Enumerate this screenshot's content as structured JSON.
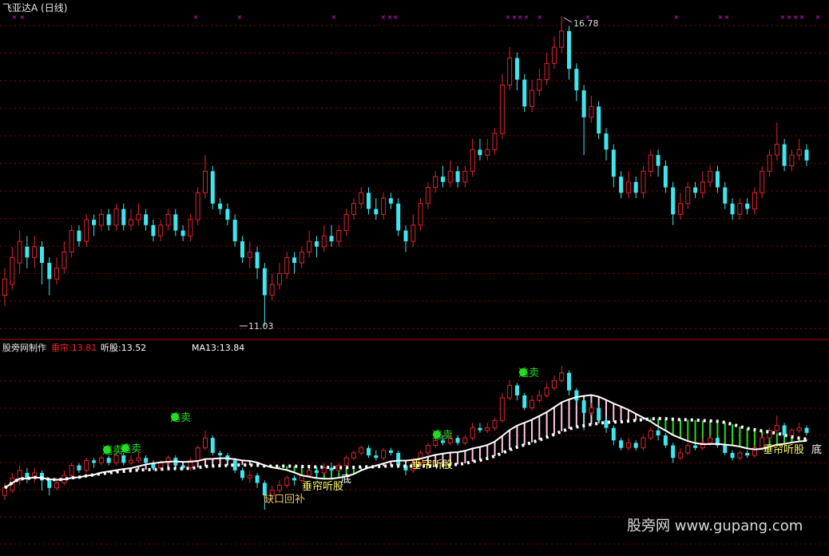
{
  "window": {
    "title": "飞亚达A (日线)"
  },
  "indicator_header": {
    "author_label": "股旁网制作",
    "items": [
      {
        "label": "垂帘",
        "value": "13.81",
        "color": "#ff2020"
      },
      {
        "label": "听股",
        "value": "13.52",
        "color": "#ffffff"
      },
      {
        "label": "MA13",
        "value": "13.84",
        "color": "#ffffff"
      }
    ]
  },
  "colors": {
    "background": "#000000",
    "up_candle": "#e0232d",
    "down_candle": "#3ee6ee",
    "grid": "#8b0000",
    "markers": "#e020e0",
    "signal_green": "#22dd22",
    "pink_hist": "#ffc8e6",
    "label_orange": "#e8c060",
    "label_yellow": "#ffff66"
  },
  "price_annotations": {
    "high": "16.78",
    "low": "11.03"
  },
  "signal_labels": {
    "sell": "逃卖",
    "curtain_stock": "垂帘听股",
    "gap_fill": "缺口回补",
    "bottom": "底"
  },
  "watermark": {
    "text": "股旁网  www.gupang.com"
  },
  "chart_data": {
    "type": "candlestick",
    "title": "飞亚达A (日线)",
    "ylim": [
      10.6,
      17.4
    ],
    "high": 16.78,
    "low": 11.03,
    "indicator": {
      "垂帘": 13.81,
      "听股": 13.52,
      "MA13": 13.84
    },
    "candles": [
      {
        "o": 11.6,
        "c": 11.9,
        "h": 12.1,
        "l": 11.4
      },
      {
        "o": 11.8,
        "c": 12.3,
        "h": 12.5,
        "l": 11.7
      },
      {
        "o": 12.2,
        "c": 12.6,
        "h": 12.8,
        "l": 12.0
      },
      {
        "o": 12.5,
        "c": 12.3,
        "h": 12.7,
        "l": 12.1
      },
      {
        "o": 12.3,
        "c": 12.5,
        "h": 12.7,
        "l": 12.1
      },
      {
        "o": 12.5,
        "c": 12.2,
        "h": 12.6,
        "l": 11.8
      },
      {
        "o": 12.2,
        "c": 11.9,
        "h": 12.3,
        "l": 11.6
      },
      {
        "o": 11.9,
        "c": 12.1,
        "h": 12.3,
        "l": 11.8
      },
      {
        "o": 12.1,
        "c": 12.4,
        "h": 12.6,
        "l": 12.0
      },
      {
        "o": 12.4,
        "c": 12.8,
        "h": 12.9,
        "l": 12.3
      },
      {
        "o": 12.8,
        "c": 12.6,
        "h": 12.9,
        "l": 12.5
      },
      {
        "o": 12.6,
        "c": 13.0,
        "h": 13.1,
        "l": 12.5
      },
      {
        "o": 13.0,
        "c": 12.9,
        "h": 13.1,
        "l": 12.7
      },
      {
        "o": 12.9,
        "c": 13.1,
        "h": 13.2,
        "l": 12.8
      },
      {
        "o": 13.1,
        "c": 12.9,
        "h": 13.2,
        "l": 12.8
      },
      {
        "o": 12.9,
        "c": 13.2,
        "h": 13.3,
        "l": 12.8
      },
      {
        "o": 13.2,
        "c": 12.9,
        "h": 13.3,
        "l": 12.8
      },
      {
        "o": 12.9,
        "c": 13.0,
        "h": 13.2,
        "l": 12.8
      },
      {
        "o": 13.0,
        "c": 13.1,
        "h": 13.3,
        "l": 12.9
      },
      {
        "o": 13.1,
        "c": 12.9,
        "h": 13.2,
        "l": 12.8
      },
      {
        "o": 12.9,
        "c": 12.7,
        "h": 13.0,
        "l": 12.6
      },
      {
        "o": 12.7,
        "c": 12.9,
        "h": 13.0,
        "l": 12.6
      },
      {
        "o": 12.9,
        "c": 13.1,
        "h": 13.2,
        "l": 12.8
      },
      {
        "o": 13.1,
        "c": 12.8,
        "h": 13.2,
        "l": 12.7
      },
      {
        "o": 12.8,
        "c": 12.7,
        "h": 12.9,
        "l": 12.6
      },
      {
        "o": 12.7,
        "c": 13.0,
        "h": 13.1,
        "l": 12.6
      },
      {
        "o": 13.0,
        "c": 13.5,
        "h": 13.6,
        "l": 12.9
      },
      {
        "o": 13.5,
        "c": 13.9,
        "h": 14.2,
        "l": 13.4
      },
      {
        "o": 13.9,
        "c": 13.3,
        "h": 14.0,
        "l": 13.2
      },
      {
        "o": 13.3,
        "c": 13.2,
        "h": 13.4,
        "l": 13.1
      },
      {
        "o": 13.2,
        "c": 13.0,
        "h": 13.3,
        "l": 12.9
      },
      {
        "o": 13.0,
        "c": 12.6,
        "h": 13.1,
        "l": 12.5
      },
      {
        "o": 12.6,
        "c": 12.3,
        "h": 12.7,
        "l": 12.2
      },
      {
        "o": 12.3,
        "c": 12.4,
        "h": 12.6,
        "l": 12.1
      },
      {
        "o": 12.4,
        "c": 12.1,
        "h": 12.5,
        "l": 11.9
      },
      {
        "o": 12.1,
        "c": 11.6,
        "h": 12.2,
        "l": 11.03
      },
      {
        "o": 11.6,
        "c": 11.8,
        "h": 12.0,
        "l": 11.5
      },
      {
        "o": 11.8,
        "c": 12.0,
        "h": 12.2,
        "l": 11.7
      },
      {
        "o": 12.0,
        "c": 12.3,
        "h": 12.4,
        "l": 11.9
      },
      {
        "o": 12.3,
        "c": 12.2,
        "h": 12.4,
        "l": 12.0
      },
      {
        "o": 12.2,
        "c": 12.4,
        "h": 12.5,
        "l": 12.1
      },
      {
        "o": 12.4,
        "c": 12.6,
        "h": 12.8,
        "l": 12.3
      },
      {
        "o": 12.6,
        "c": 12.5,
        "h": 12.7,
        "l": 12.3
      },
      {
        "o": 12.5,
        "c": 12.7,
        "h": 12.9,
        "l": 12.4
      },
      {
        "o": 12.7,
        "c": 12.6,
        "h": 12.9,
        "l": 12.5
      },
      {
        "o": 12.6,
        "c": 12.8,
        "h": 12.9,
        "l": 12.5
      },
      {
        "o": 12.8,
        "c": 13.1,
        "h": 13.2,
        "l": 12.7
      },
      {
        "o": 13.1,
        "c": 13.3,
        "h": 13.4,
        "l": 13.0
      },
      {
        "o": 13.3,
        "c": 13.5,
        "h": 13.6,
        "l": 13.2
      },
      {
        "o": 13.5,
        "c": 13.2,
        "h": 13.6,
        "l": 13.1
      },
      {
        "o": 13.2,
        "c": 13.1,
        "h": 13.4,
        "l": 13.0
      },
      {
        "o": 13.1,
        "c": 13.4,
        "h": 13.5,
        "l": 13.0
      },
      {
        "o": 13.4,
        "c": 13.3,
        "h": 13.5,
        "l": 13.2
      },
      {
        "o": 13.3,
        "c": 12.8,
        "h": 13.4,
        "l": 12.7
      },
      {
        "o": 12.8,
        "c": 12.6,
        "h": 12.9,
        "l": 12.4
      },
      {
        "o": 12.6,
        "c": 12.9,
        "h": 13.1,
        "l": 12.5
      },
      {
        "o": 12.9,
        "c": 13.3,
        "h": 13.4,
        "l": 12.8
      },
      {
        "o": 13.3,
        "c": 13.6,
        "h": 13.7,
        "l": 13.2
      },
      {
        "o": 13.6,
        "c": 13.8,
        "h": 13.9,
        "l": 13.5
      },
      {
        "o": 13.8,
        "c": 13.7,
        "h": 14.0,
        "l": 13.6
      },
      {
        "o": 13.7,
        "c": 13.9,
        "h": 14.1,
        "l": 13.6
      },
      {
        "o": 13.9,
        "c": 13.7,
        "h": 14.0,
        "l": 13.6
      },
      {
        "o": 13.7,
        "c": 13.9,
        "h": 14.0,
        "l": 13.6
      },
      {
        "o": 13.9,
        "c": 14.3,
        "h": 14.5,
        "l": 13.8
      },
      {
        "o": 14.3,
        "c": 14.2,
        "h": 14.5,
        "l": 14.1
      },
      {
        "o": 14.2,
        "c": 14.3,
        "h": 14.5,
        "l": 14.1
      },
      {
        "o": 14.3,
        "c": 14.6,
        "h": 14.7,
        "l": 14.2
      },
      {
        "o": 14.6,
        "c": 15.5,
        "h": 15.7,
        "l": 14.5
      },
      {
        "o": 15.5,
        "c": 16.0,
        "h": 16.2,
        "l": 15.4
      },
      {
        "o": 16.0,
        "c": 15.6,
        "h": 16.1,
        "l": 15.4
      },
      {
        "o": 15.6,
        "c": 15.1,
        "h": 15.7,
        "l": 15.0
      },
      {
        "o": 15.1,
        "c": 15.4,
        "h": 15.6,
        "l": 15.0
      },
      {
        "o": 15.4,
        "c": 15.6,
        "h": 15.8,
        "l": 15.3
      },
      {
        "o": 15.6,
        "c": 15.9,
        "h": 16.1,
        "l": 15.5
      },
      {
        "o": 15.9,
        "c": 16.2,
        "h": 16.4,
        "l": 15.8
      },
      {
        "o": 16.2,
        "c": 16.5,
        "h": 16.78,
        "l": 16.1
      },
      {
        "o": 16.5,
        "c": 15.8,
        "h": 16.6,
        "l": 15.6
      },
      {
        "o": 15.8,
        "c": 15.4,
        "h": 15.9,
        "l": 15.2
      },
      {
        "o": 15.4,
        "c": 14.9,
        "h": 15.5,
        "l": 14.2
      },
      {
        "o": 14.9,
        "c": 15.1,
        "h": 15.3,
        "l": 14.8
      },
      {
        "o": 15.1,
        "c": 14.6,
        "h": 15.2,
        "l": 14.5
      },
      {
        "o": 14.6,
        "c": 14.3,
        "h": 14.7,
        "l": 14.1
      },
      {
        "o": 14.3,
        "c": 13.8,
        "h": 14.4,
        "l": 13.6
      },
      {
        "o": 13.8,
        "c": 13.5,
        "h": 13.9,
        "l": 13.4
      },
      {
        "o": 13.5,
        "c": 13.7,
        "h": 13.9,
        "l": 13.4
      },
      {
        "o": 13.7,
        "c": 13.5,
        "h": 13.8,
        "l": 13.4
      },
      {
        "o": 13.5,
        "c": 13.9,
        "h": 14.0,
        "l": 13.4
      },
      {
        "o": 13.9,
        "c": 14.2,
        "h": 14.3,
        "l": 13.8
      },
      {
        "o": 14.2,
        "c": 14.0,
        "h": 14.3,
        "l": 13.8
      },
      {
        "o": 14.0,
        "c": 13.6,
        "h": 14.1,
        "l": 13.5
      },
      {
        "o": 13.6,
        "c": 13.1,
        "h": 13.7,
        "l": 12.9
      },
      {
        "o": 13.1,
        "c": 13.3,
        "h": 13.5,
        "l": 13.0
      },
      {
        "o": 13.3,
        "c": 13.6,
        "h": 13.7,
        "l": 13.2
      },
      {
        "o": 13.6,
        "c": 13.5,
        "h": 13.7,
        "l": 13.4
      },
      {
        "o": 13.5,
        "c": 13.7,
        "h": 13.9,
        "l": 13.4
      },
      {
        "o": 13.7,
        "c": 13.9,
        "h": 14.0,
        "l": 13.6
      },
      {
        "o": 13.9,
        "c": 13.6,
        "h": 14.0,
        "l": 13.5
      },
      {
        "o": 13.6,
        "c": 13.3,
        "h": 13.7,
        "l": 13.2
      },
      {
        "o": 13.3,
        "c": 13.1,
        "h": 13.4,
        "l": 13.0
      },
      {
        "o": 13.1,
        "c": 13.3,
        "h": 13.4,
        "l": 13.0
      },
      {
        "o": 13.3,
        "c": 13.2,
        "h": 13.4,
        "l": 13.1
      },
      {
        "o": 13.2,
        "c": 13.5,
        "h": 13.6,
        "l": 13.1
      },
      {
        "o": 13.5,
        "c": 13.9,
        "h": 14.0,
        "l": 13.4
      },
      {
        "o": 13.9,
        "c": 14.2,
        "h": 14.3,
        "l": 13.8
      },
      {
        "o": 14.2,
        "c": 14.4,
        "h": 14.8,
        "l": 14.1
      },
      {
        "o": 14.4,
        "c": 14.0,
        "h": 14.5,
        "l": 13.9
      },
      {
        "o": 14.0,
        "c": 14.2,
        "h": 14.3,
        "l": 13.9
      },
      {
        "o": 14.2,
        "c": 14.3,
        "h": 14.5,
        "l": 14.1
      },
      {
        "o": 14.3,
        "c": 14.1,
        "h": 14.4,
        "l": 14.0
      }
    ]
  }
}
